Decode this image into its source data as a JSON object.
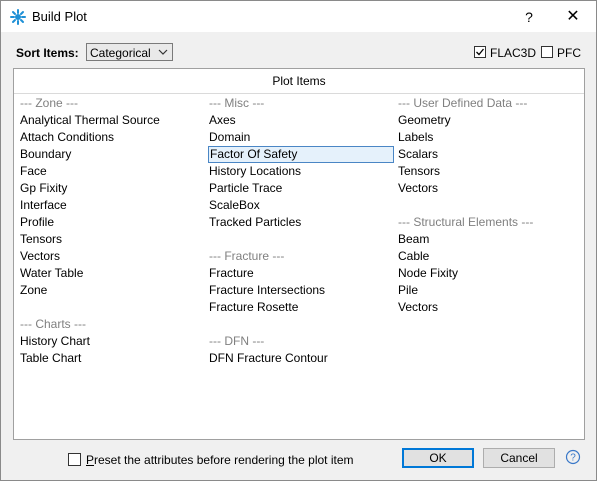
{
  "window": {
    "title": "Build Plot",
    "help_label": "?",
    "close_label": "✕"
  },
  "toolbar": {
    "sort_label": "Sort Items:",
    "sort_value": "Categorical",
    "flac3d": {
      "label": "FLAC3D",
      "checked": true
    },
    "pfc": {
      "label": "PFC",
      "checked": false
    }
  },
  "panel": {
    "title": "Plot Items",
    "columns": [
      [
        {
          "text": "--- Zone ---",
          "kind": "header"
        },
        {
          "text": "Analytical Thermal Source"
        },
        {
          "text": "Attach Conditions"
        },
        {
          "text": "Boundary"
        },
        {
          "text": "Face"
        },
        {
          "text": "Gp Fixity"
        },
        {
          "text": "Interface"
        },
        {
          "text": "Profile"
        },
        {
          "text": "Tensors"
        },
        {
          "text": "Vectors"
        },
        {
          "text": "Water Table"
        },
        {
          "text": "Zone"
        },
        {
          "text": "",
          "kind": "blank"
        },
        {
          "text": "--- Charts ---",
          "kind": "header"
        },
        {
          "text": "History Chart"
        },
        {
          "text": "Table Chart"
        }
      ],
      [
        {
          "text": "--- Misc ---",
          "kind": "header"
        },
        {
          "text": "Axes"
        },
        {
          "text": "Domain"
        },
        {
          "text": "Factor Of Safety",
          "selected": true
        },
        {
          "text": "History Locations"
        },
        {
          "text": "Particle Trace"
        },
        {
          "text": "ScaleBox"
        },
        {
          "text": "Tracked Particles"
        },
        {
          "text": "",
          "kind": "blank"
        },
        {
          "text": "--- Fracture ---",
          "kind": "header"
        },
        {
          "text": "Fracture"
        },
        {
          "text": "Fracture Intersections"
        },
        {
          "text": "Fracture Rosette"
        },
        {
          "text": "",
          "kind": "blank"
        },
        {
          "text": "--- DFN ---",
          "kind": "header"
        },
        {
          "text": "DFN Fracture Contour"
        }
      ],
      [
        {
          "text": "--- User Defined Data ---",
          "kind": "header"
        },
        {
          "text": "Geometry"
        },
        {
          "text": "Labels"
        },
        {
          "text": "Scalars"
        },
        {
          "text": "Tensors"
        },
        {
          "text": "Vectors"
        },
        {
          "text": "",
          "kind": "blank"
        },
        {
          "text": "--- Structural Elements ---",
          "kind": "header"
        },
        {
          "text": "Beam"
        },
        {
          "text": "Cable"
        },
        {
          "text": "Node Fixity"
        },
        {
          "text": "Pile"
        },
        {
          "text": "Vectors"
        }
      ]
    ]
  },
  "footer": {
    "preset_label_first": "P",
    "preset_label_rest": "reset the attributes before rendering the plot item",
    "preset_checked": false,
    "ok_label": "OK",
    "cancel_label": "Cancel"
  },
  "colors": {
    "selection_bg": "#e5f1fb",
    "selection_border": "#4a86c5",
    "header_text": "#808080",
    "ok_border": "#0078d7"
  }
}
